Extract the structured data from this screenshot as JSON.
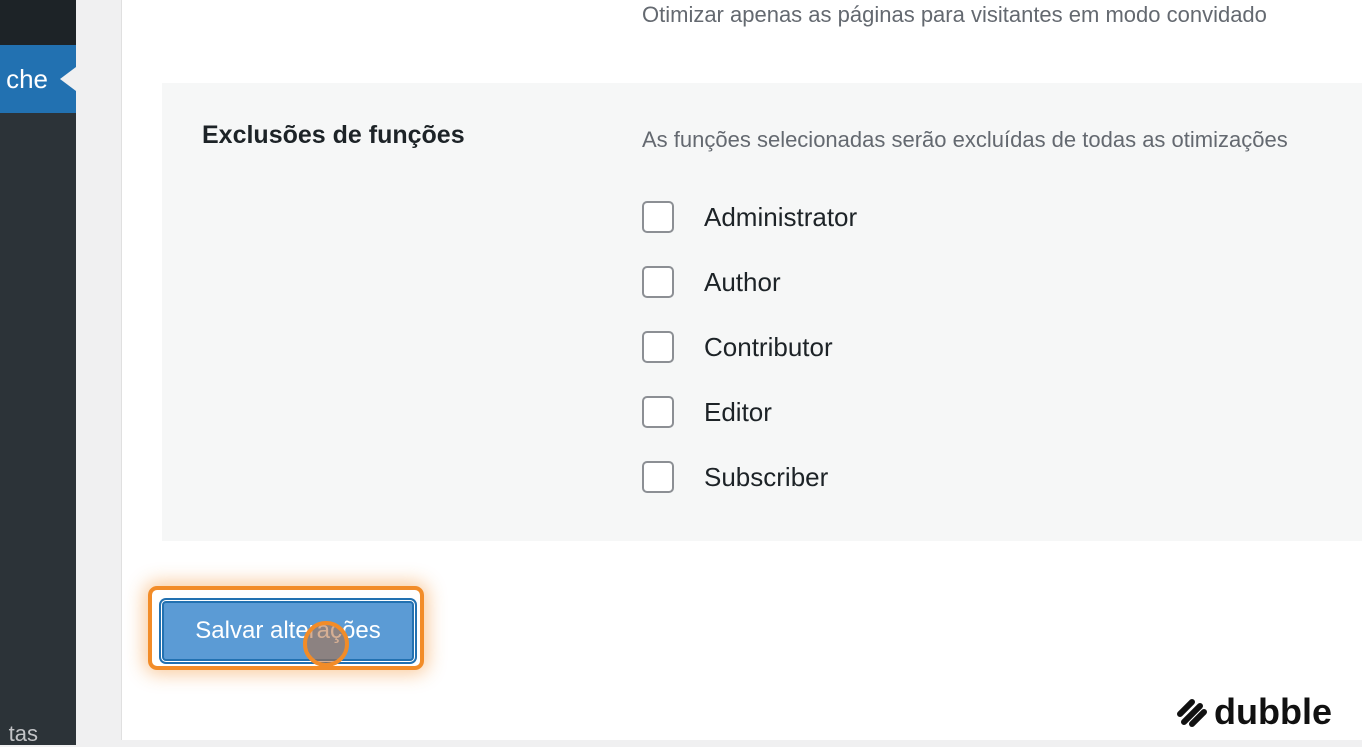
{
  "sidebar": {
    "active_item_label": "che",
    "bottom_item_label": "tas"
  },
  "settings": {
    "guest_mode_description": "Otimizar apenas as páginas para visitantes em modo convidado",
    "role_exclusions": {
      "title": "Exclusões de funções",
      "description": "As funções selecionadas serão excluídas de todas as otimizações",
      "roles": [
        {
          "label": "Administrator",
          "checked": false
        },
        {
          "label": "Author",
          "checked": false
        },
        {
          "label": "Contributor",
          "checked": false
        },
        {
          "label": "Editor",
          "checked": false
        },
        {
          "label": "Subscriber",
          "checked": false
        }
      ]
    },
    "save_button_label": "Salvar alterações"
  },
  "watermark": {
    "brand_name": "dubble",
    "icon": "dubble-logo-icon"
  },
  "colors": {
    "accent": "#2271b1",
    "highlight": "#f28c28",
    "sidebar": "#2c3338"
  }
}
